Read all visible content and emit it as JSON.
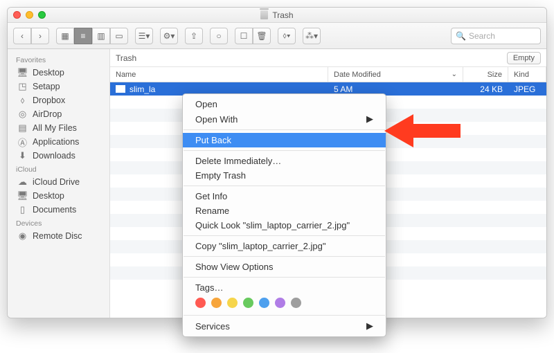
{
  "window": {
    "title": "Trash"
  },
  "toolbar": {
    "search_placeholder": "Search"
  },
  "sidebar": {
    "sections": [
      {
        "title": "Favorites",
        "items": [
          {
            "icon": "desktop",
            "label": "Desktop"
          },
          {
            "icon": "setapp",
            "label": "Setapp"
          },
          {
            "icon": "dropbox",
            "label": "Dropbox"
          },
          {
            "icon": "airdrop",
            "label": "AirDrop"
          },
          {
            "icon": "allmyfiles",
            "label": "All My Files"
          },
          {
            "icon": "applications",
            "label": "Applications"
          },
          {
            "icon": "downloads",
            "label": "Downloads"
          }
        ]
      },
      {
        "title": "iCloud",
        "items": [
          {
            "icon": "icloud",
            "label": "iCloud Drive"
          },
          {
            "icon": "desktop",
            "label": "Desktop"
          },
          {
            "icon": "documents",
            "label": "Documents"
          }
        ]
      },
      {
        "title": "Devices",
        "items": [
          {
            "icon": "disc",
            "label": "Remote Disc"
          }
        ]
      }
    ]
  },
  "pathbar": {
    "location": "Trash",
    "empty_button": "Empty"
  },
  "columns": {
    "name": "Name",
    "date": "Date Modified",
    "size": "Size",
    "kind": "Kind"
  },
  "file": {
    "name": "slim_la",
    "date_partial": "5 AM",
    "size": "24 KB",
    "kind": "JPEG"
  },
  "context_menu": {
    "open": "Open",
    "open_with": "Open With",
    "put_back": "Put Back",
    "delete_immediately": "Delete Immediately…",
    "empty_trash": "Empty Trash",
    "get_info": "Get Info",
    "rename": "Rename",
    "quick_look": "Quick Look \"slim_laptop_carrier_2.jpg\"",
    "copy": "Copy \"slim_laptop_carrier_2.jpg\"",
    "show_view_options": "Show View Options",
    "tags": "Tags…",
    "services": "Services",
    "tag_colors": [
      "#ff5a52",
      "#f7a53b",
      "#f6d54b",
      "#68ca5e",
      "#4ea0ee",
      "#b07de6",
      "#9e9e9e"
    ]
  },
  "arrow_color": "#ff3b1f"
}
